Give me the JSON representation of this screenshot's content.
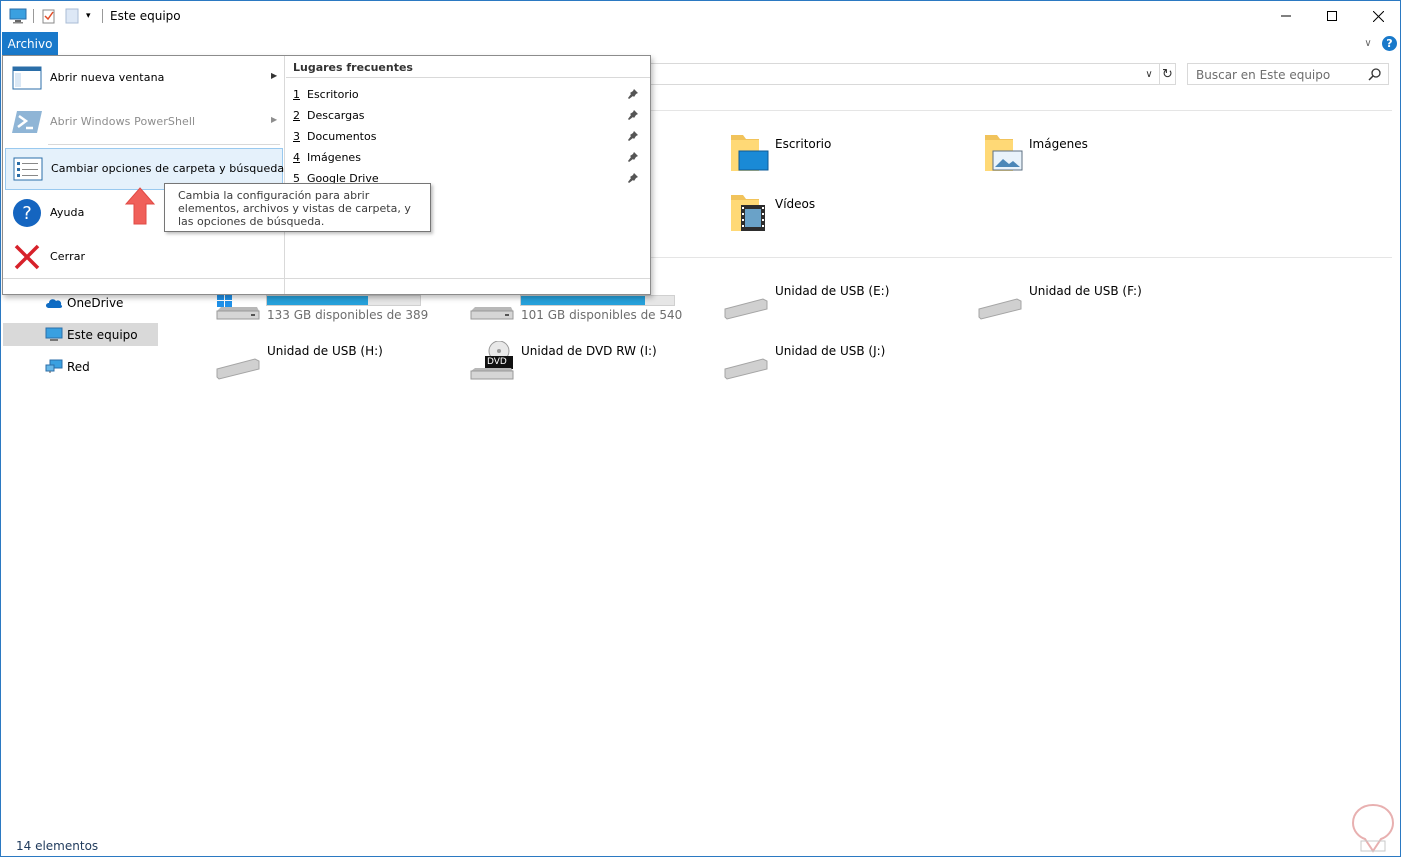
{
  "titlebar": {
    "title": "Este equipo"
  },
  "ribbon": {
    "file_tab": "Archivo",
    "help": "?"
  },
  "search": {
    "placeholder": "Buscar en Este equipo"
  },
  "file_menu": {
    "items": [
      {
        "label": "Abrir nueva ventana",
        "icon": "window-icon"
      },
      {
        "label": "Abrir Windows PowerShell",
        "icon": "powershell-icon"
      },
      {
        "label": "Cambiar opciones de carpeta y búsqueda",
        "icon": "folder-options-icon"
      },
      {
        "label": "Ayuda",
        "icon": "help-icon"
      },
      {
        "label": "Cerrar",
        "icon": "close-x-icon"
      }
    ],
    "frequent_title": "Lugares frecuentes",
    "frequent": [
      {
        "num": "1",
        "label": "Escritorio"
      },
      {
        "num": "2",
        "label": "Descargas"
      },
      {
        "num": "3",
        "label": "Documentos"
      },
      {
        "num": "4",
        "label": "Imágenes"
      },
      {
        "num": "5",
        "label": "Google Drive"
      }
    ],
    "tooltip": "Cambia la configuración para abrir elementos, archivos y vistas de carpeta, y las opciones de búsqueda."
  },
  "nav": {
    "items": [
      {
        "label": "OneDrive"
      },
      {
        "label": "Este equipo"
      },
      {
        "label": "Red"
      }
    ]
  },
  "folders": [
    {
      "label": "Escritorio"
    },
    {
      "label": "Imágenes"
    },
    {
      "label": "Vídeos"
    }
  ],
  "drives": [
    {
      "label": "133 GB disponibles de 389",
      "used_fraction": 0.66
    },
    {
      "label": "101 GB disponibles de 540",
      "used_fraction": 0.81
    },
    {
      "label": "Unidad de USB (E:)"
    },
    {
      "label": "Unidad de USB (F:)"
    },
    {
      "label": "Unidad de USB (H:)"
    },
    {
      "label": "Unidad de DVD RW (I:)",
      "badge": "DVD"
    },
    {
      "label": "Unidad de USB (J:)"
    }
  ],
  "status": {
    "count": "14 elementos"
  },
  "colors": {
    "accent": "#1979ca",
    "bar_fill": "#26a0da",
    "highlight": "#e5f1fb"
  }
}
